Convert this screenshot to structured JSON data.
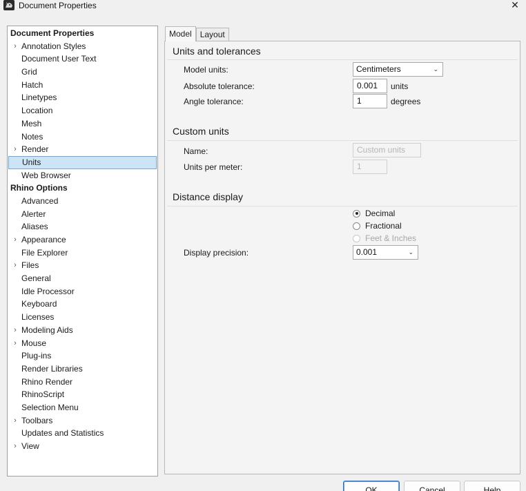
{
  "window": {
    "title": "Document Properties",
    "close_glyph": "✕",
    "app_icon": "rhino-icon"
  },
  "tree": {
    "items": [
      {
        "label": "Document Properties",
        "header": true
      },
      {
        "label": "Annotation Styles",
        "expandable": true
      },
      {
        "label": "Document User Text"
      },
      {
        "label": "Grid"
      },
      {
        "label": "Hatch"
      },
      {
        "label": "Linetypes"
      },
      {
        "label": "Location"
      },
      {
        "label": "Mesh"
      },
      {
        "label": "Notes"
      },
      {
        "label": "Render",
        "expandable": true
      },
      {
        "label": "Units",
        "selected": true
      },
      {
        "label": "Web Browser"
      },
      {
        "label": "Rhino Options",
        "header": true
      },
      {
        "label": "Advanced"
      },
      {
        "label": "Alerter"
      },
      {
        "label": "Aliases"
      },
      {
        "label": "Appearance",
        "expandable": true
      },
      {
        "label": "File Explorer"
      },
      {
        "label": "Files",
        "expandable": true
      },
      {
        "label": "General"
      },
      {
        "label": "Idle Processor"
      },
      {
        "label": "Keyboard"
      },
      {
        "label": "Licenses"
      },
      {
        "label": "Modeling Aids",
        "expandable": true
      },
      {
        "label": "Mouse",
        "expandable": true
      },
      {
        "label": "Plug-ins"
      },
      {
        "label": "Render Libraries"
      },
      {
        "label": "Rhino Render"
      },
      {
        "label": "RhinoScript"
      },
      {
        "label": "Selection Menu"
      },
      {
        "label": "Toolbars",
        "expandable": true
      },
      {
        "label": "Updates and Statistics"
      },
      {
        "label": "View",
        "expandable": true
      }
    ],
    "chevron_glyph": "›"
  },
  "tabs": [
    {
      "label": "Model",
      "active": true
    },
    {
      "label": "Layout",
      "active": false
    }
  ],
  "units_tolerances": {
    "title": "Units and tolerances",
    "model_units_label": "Model units:",
    "model_units_value": "Centimeters",
    "absolute_tolerance_label": "Absolute tolerance:",
    "absolute_tolerance_value": "0.001",
    "absolute_tolerance_unit": "units",
    "angle_tolerance_label": "Angle tolerance:",
    "angle_tolerance_value": "1",
    "angle_tolerance_unit": "degrees"
  },
  "custom_units": {
    "title": "Custom units",
    "name_label": "Name:",
    "name_placeholder": "Custom units",
    "units_per_meter_label": "Units per meter:",
    "units_per_meter_value": "1"
  },
  "distance_display": {
    "title": "Distance display",
    "options": [
      {
        "label": "Decimal",
        "checked": true,
        "disabled": false
      },
      {
        "label": "Fractional",
        "checked": false,
        "disabled": false
      },
      {
        "label": "Feet & Inches",
        "checked": false,
        "disabled": true
      }
    ],
    "display_precision_label": "Display precision:",
    "display_precision_value": "0.001"
  },
  "buttons": {
    "ok": "OK",
    "cancel": "Cancel",
    "help": "Help"
  },
  "colors": {
    "selection_bg": "#cde4f7",
    "selection_border": "#6fa8dc",
    "ok_border": "#2f6fbd"
  }
}
